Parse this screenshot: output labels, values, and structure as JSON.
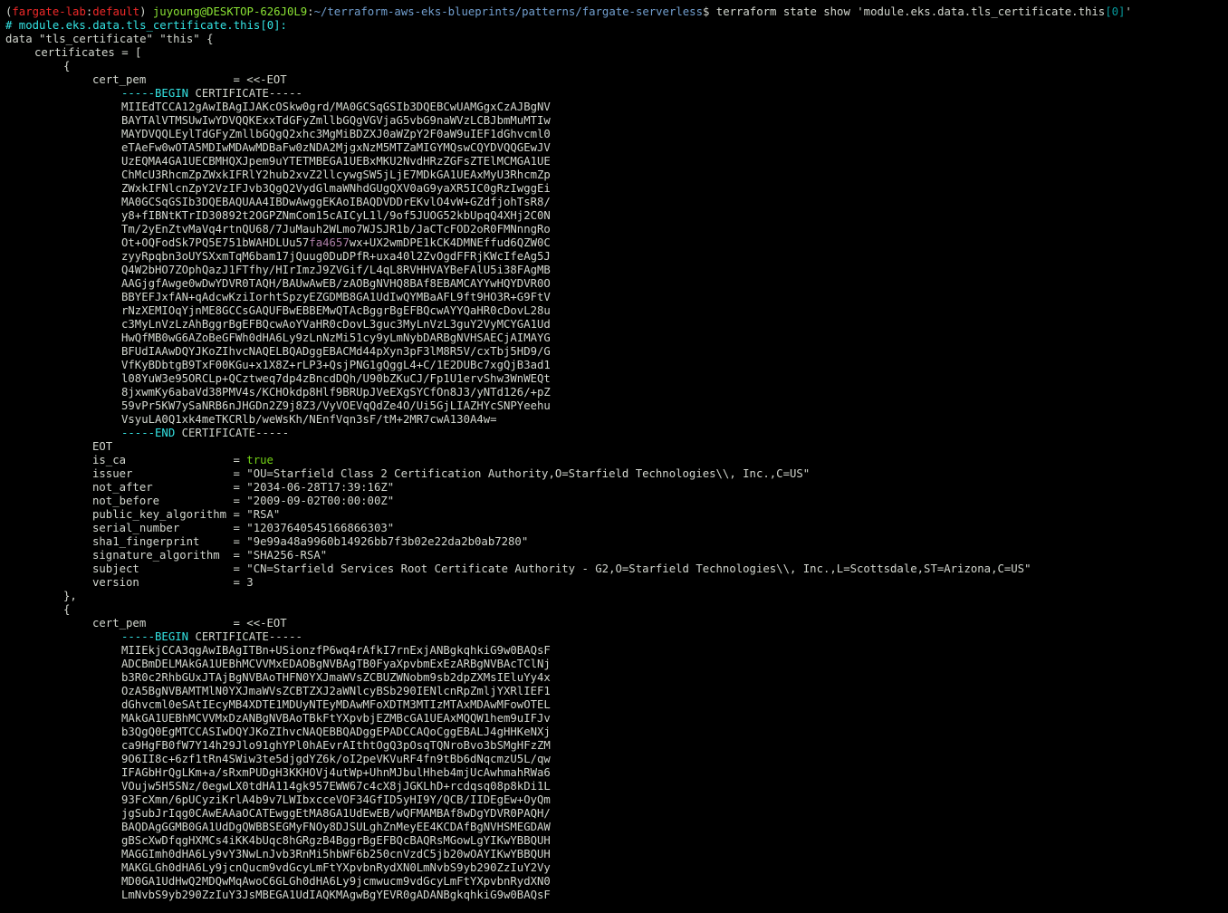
{
  "prompt": {
    "open_paren": "(",
    "workspace": "fargate-lab",
    "colon": ":",
    "profile": "default",
    "close_paren": ")",
    "user_host": "juyoung@DESKTOP-626J0L9",
    "path_colon": ":",
    "path": "~/terraform-aws-eks-blueprints/patterns/fargate-serverless",
    "dollar": "$",
    "command_prefix": " terraform state show 'module.eks.data.tls_certificate.this",
    "command_index": "[0]",
    "command_suffix": "'"
  },
  "output": {
    "comment": "# module.eks.data.tls_certificate.this[0]:",
    "data_open": "data \"tls_certificate\" \"this\" {",
    "certificates_open": "certificates = [",
    "brace_open": "{",
    "brace_close": "},",
    "cert_pem_key": "cert_pem             ",
    "cert_pem_eq": "= <<-EOT",
    "begin_dashes": "-----",
    "begin_word": "BEGIN",
    "begin_tail": " CERTIFICATE-----",
    "end_dashes": "-----",
    "end_word": "END",
    "end_tail": " CERTIFICATE-----",
    "eot": "EOT",
    "cert1_lines": [
      "MIIEdTCCA12gAwIBAgIJAKcOSkw0grd/MA0GCSqGSIb3DQEBCwUAMGgxCzAJBgNV",
      "BAYTAlVTMSUwIwYDVQQKExxTdGFyZmllbGQgVGVjaG5vbG9naWVzLCBJbmMuMTIw",
      "MAYDVQQLEylTdGFyZmllbGQgQ2xhc3MgMiBDZXJ0aWZpY2F0aW9uIEF1dGhvcml0",
      "eTAeFw0wOTA5MDIwMDAwMDBaFw0zNDA2MjgxNzM5MTZaMIGYMQswCQYDVQQGEwJV",
      "UzEQMA4GA1UECBMHQXJpem9uYTETMBEGA1UEBxMKU2NvdHRzZGFsZTElMCMGA1UE",
      "ChMcU3RhcmZpZWxkIFRlY2hub2xvZ2llcywgSW5jLjE7MDkGA1UEAxMyU3RhcmZp",
      "ZWxkIFNlcnZpY2VzIFJvb3QgQ2VydGlmaWNhdGUgQXV0aG9yaXR5IC0gRzIwggEi",
      "MA0GCSqGSIb3DQEBAQUAA4IBDwAwggEKAoIBAQDVDDrEKvlO4vW+GZdfjohTsR8/",
      "y8+fIBNtKTrID30892t2OGPZNmCom15cAICyL1l/9of5JUOG52kbUpqQ4XHj2C0N",
      "Tm/2yEnZtvMaVq4rtnQU68/7JuMauh2WLmo7WJSJR1b/JaCTcFOD2oR0FMNnngRo",
      "Ot+OQFodSk7PQ5E751bWAHDLUu57",
      "zyyRpqbn3oUYSXxmTqM6bam17jQuug0DuDPfR+uxa40l2ZvOgdFFRjKWcIfeAg5J",
      "Q4W2bHO7ZOphQazJ1FTfhy/HIrImzJ9ZVGif/L4qL8RVHHVAYBeFAlU5i38FAgMB",
      "AAGjgfAwge0wDwYDVR0TAQH/BAUwAwEB/zAOBgNVHQ8BAf8EBAMCAYYwHQYDVR0O",
      "BBYEFJxfAN+qAdcwKziIorhtSpzyEZGDMB8GA1UdIwQYMBaAFL9ft9HO3R+G9FtV",
      "rNzXEMIOqYjnME8GCCsGAQUFBwEBBEMwQTAcBggrBgEFBQcwAYYQaHR0cDovL28u",
      "c3MyLnVzLzAhBggrBgEFBQcwAoYVaHR0cDovL3guc3MyLnVzL3guY2VyMCYGA1Ud",
      "HwQfMB0wG6AZoBeGFWh0dHA6Ly9zLnNzMi51cy9yLmNybDARBgNVHSAECjAIMAYG",
      "BFUdIAAwDQYJKoZIhvcNAQELBQADggEBACMd44pXyn3pF3lM8R5V/cxTbj5HD9/G",
      "VfKyBDbtgB9TxF00KGu+x1X8Z+rLP3+QsjPNG1gQggL4+C/1E2DUBc7xgQjB3ad1",
      "l08YuW3e95ORCLp+QCztweq7dp4zBncdDQh/U90bZKuCJ/Fp1U1ervShw3WnWEQt",
      "8jxwmKy6abaVd38PMV4s/KCHOkdp8Hlf9BRUpJVeEXgSYCfOn8J3/yNTd126/+pZ",
      "59vPr5KW7ySaNRB6nJHGDn2Z9j8Z3/VyVOEVqQdZe4O/Ui5GjLIAZHYcSNPYeehu",
      "VsyuLA0Q1xk4meTKCRlb/weWsKh/NEnfVqn3sF/tM+2MR7cwA130A4w="
    ],
    "cert1_line10_highlight": "fa4657",
    "cert1_line10_tail": "wx+UX2wmDPE1kCK4DMNEffud6QZW0C",
    "fields": [
      {
        "key": "is_ca                ",
        "value": "true",
        "type": "bool"
      },
      {
        "key": "issuer               ",
        "value": "\"OU=Starfield Class 2 Certification Authority,O=Starfield Technologies\\\\, Inc.,C=US\"",
        "type": "string"
      },
      {
        "key": "not_after            ",
        "value": "\"2034-06-28T17:39:16Z\"",
        "type": "string"
      },
      {
        "key": "not_before           ",
        "value": "\"2009-09-02T00:00:00Z\"",
        "type": "string"
      },
      {
        "key": "public_key_algorithm ",
        "value": "\"RSA\"",
        "type": "string"
      },
      {
        "key": "serial_number        ",
        "value": "\"12037640545166866303\"",
        "type": "string"
      },
      {
        "key": "sha1_fingerprint     ",
        "value": "\"9e99a48a9960b14926bb7f3b02e22da2b0ab7280\"",
        "type": "string"
      },
      {
        "key": "signature_algorithm  ",
        "value": "\"SHA256-RSA\"",
        "type": "string"
      },
      {
        "key": "subject              ",
        "value": "\"CN=Starfield Services Root Certificate Authority - G2,O=Starfield Technologies\\\\, Inc.,L=Scottsdale,ST=Arizona,C=US\"",
        "type": "string"
      },
      {
        "key": "version              ",
        "value": "3",
        "type": "number"
      }
    ],
    "cert2_lines": [
      "MIIEkjCCA3qgAwIBAgITBn+USionzfP6wq4rAfkI7rnExjANBgkqhkiG9w0BAQsF",
      "ADCBmDELMAkGA1UEBhMCVVMxEDAOBgNVBAgTB0FyaXpvbmExEzARBgNVBAcTClNj",
      "b3R0c2RhbGUxJTAjBgNVBAoTHFN0YXJmaWVsZCBUZWNobm9sb2dpZXMsIEluYy4x",
      "OzA5BgNVBAMTMlN0YXJmaWVsZCBTZXJ2aWNlcyBSb290IENlcnRpZmljYXRlIEF1",
      "dGhvcml0eSAtIEcyMB4XDTE1MDUyNTEyMDAwMFoXDTM3MTIzMTAxMDAwMFowOTEL",
      "MAkGA1UEBhMCVVMxDzANBgNVBAoTBkFtYXpvbjEZMBcGA1UEAxMQQW1hem9uIFJv",
      "b3QgQ0EgMTCCASIwDQYJKoZIhvcNAQEBBQADggEPADCCAQoCggEBALJ4gHHKeNXj",
      "ca9HgFB0fW7Y14h29Jlo91ghYPl0hAEvrAIthtOgQ3pOsqTQNroBvo3bSMgHFzZM",
      "9O6II8c+6zf1tRn4SWiw3te5djgdYZ6k/oI2peVKVuRF4fn9tBb6dNqcmzU5L/qw",
      "IFAGbHrQgLKm+a/sRxmPUDgH3KKHOVj4utWp+UhnMJbulHheb4mjUcAwhmahRWa6",
      "VOujw5H5SNz/0egwLX0tdHA114gk957EWW67c4cX8jJGKLhD+rcdqsq08p8kDi1L",
      "93FcXmn/6pUCyziKrlA4b9v7LWIbxcceVOF34GfID5yHI9Y/QCB/IIDEgEw+OyQm",
      "jgSubJrIqg0CAwEAAaOCATEwggEtMA8GA1UdEwEB/wQFMAMBAf8wDgYDVR0PAQH/",
      "BAQDAgGGMB0GA1UdDgQWBBSEGMyFNOy8DJSULghZnMeyEE4KCDAfBgNVHSMEGDAW",
      "gBScXwDfqgHXMCs4iKK4bUqc8hGRgzB4BggrBgEFBQcBAQRsMGowLgYIKwYBBQUH",
      "MAGGImh0dHA6Ly9vY3NwLnJvb3RnMi5hbWF6b250cnVzdC5jb20wOAYIKwYBBQUH",
      "MAKGLGh0dHA6Ly9jcnQucm9vdGcyLmFtYXpvbnRydXN0LmNvbS9yb290ZzIuY2Vy",
      "MD0GA1UdHwQ2MDQwMqAwoC6GLGh0dHA6Ly9jcmwucm9vdGcyLmFtYXpvbnRydXN0",
      "LmNvbS9yb290ZzIuY3JsMBEGA1UdIAQKMAgwBgYEVR0gADANBgkqhkiG9w0BAQsF"
    ]
  }
}
